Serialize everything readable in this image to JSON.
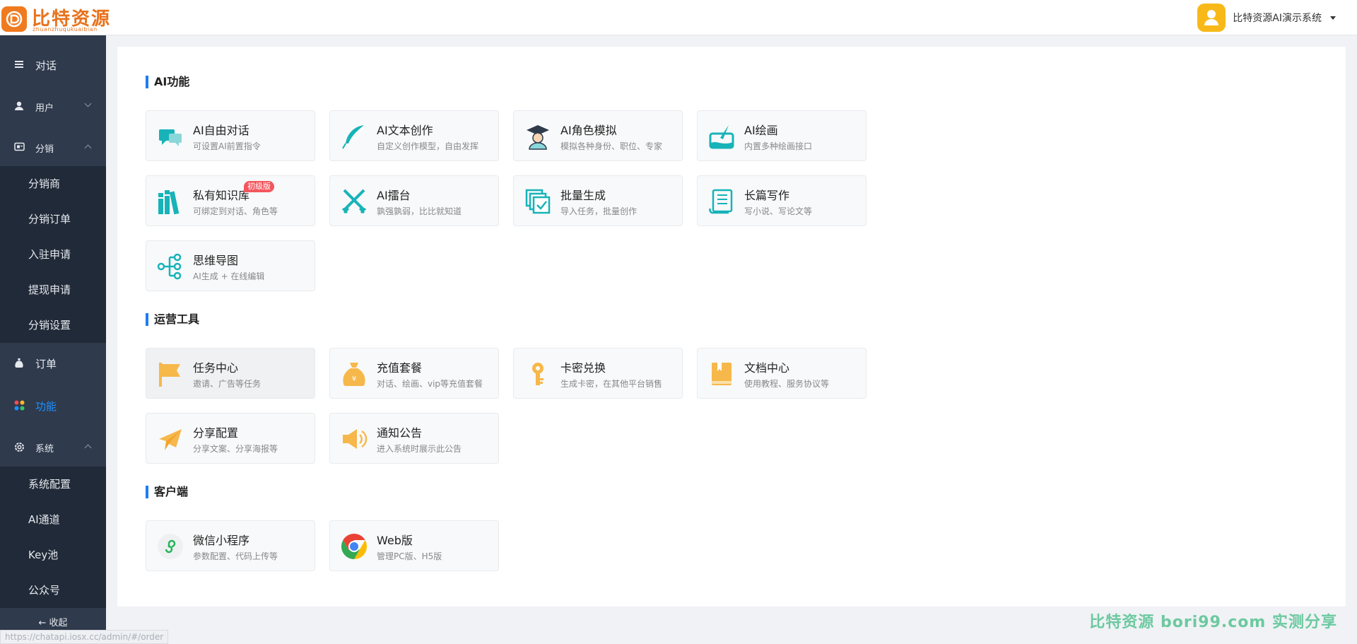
{
  "header": {
    "logo_title": "比特资源",
    "logo_subtitle": "zhuanzhuqukuaibian",
    "user_name": "比特资源AI演示系统"
  },
  "sidebar": {
    "items": [
      {
        "label": "对话",
        "icon": "menu-icon"
      },
      {
        "label": "用户",
        "icon": "user-icon"
      },
      {
        "label": "分销",
        "icon": "distribution-icon"
      },
      {
        "label": "订单",
        "icon": "money-bag-icon"
      },
      {
        "label": "功能",
        "icon": "grid-icon"
      },
      {
        "label": "系统",
        "icon": "gear-icon"
      }
    ],
    "distribution_sub": [
      "分销商",
      "分销订单",
      "入驻申请",
      "提现申请",
      "分销设置"
    ],
    "system_sub": [
      "系统配置",
      "AI通道",
      "Key池",
      "公众号"
    ],
    "collapse_label": "← 收起"
  },
  "sections": [
    {
      "title": "AI功能"
    },
    {
      "title": "运营工具"
    },
    {
      "title": "客户端"
    }
  ],
  "ai_cards": [
    {
      "title": "AI自由对话",
      "desc": "可设置AI前置指令",
      "icon": "chat-bubbles-icon"
    },
    {
      "title": "AI文本创作",
      "desc": "自定义创作模型，自由发挥",
      "icon": "feather-pen-icon"
    },
    {
      "title": "AI角色模拟",
      "desc": "模拟各种身份、职位、专家",
      "icon": "graduate-icon"
    },
    {
      "title": "AI绘画",
      "desc": "内置多种绘画接口",
      "icon": "paint-brush-icon"
    },
    {
      "title": "私有知识库",
      "desc": "可绑定到对话、角色等",
      "icon": "books-icon",
      "badge": "初级版"
    },
    {
      "title": "AI擂台",
      "desc": "孰强孰弱，比比就知道",
      "icon": "crossed-swords-icon"
    },
    {
      "title": "批量生成",
      "desc": "导入任务，批量创作",
      "icon": "batch-check-icon"
    },
    {
      "title": "长篇写作",
      "desc": "写小说、写论文等",
      "icon": "scroll-icon"
    },
    {
      "title": "思维导图",
      "desc": "AI生成 + 在线编辑",
      "icon": "mindmap-icon"
    }
  ],
  "ops_cards": [
    {
      "title": "任务中心",
      "desc": "邀请、广告等任务",
      "icon": "flag-icon"
    },
    {
      "title": "充值套餐",
      "desc": "对话、绘画、vip等充值套餐",
      "icon": "money-bag-icon"
    },
    {
      "title": "卡密兑换",
      "desc": "生成卡密，在其他平台销售",
      "icon": "key-icon"
    },
    {
      "title": "文档中心",
      "desc": "使用教程、服务协议等",
      "icon": "book-icon"
    },
    {
      "title": "分享配置",
      "desc": "分享文案、分享海报等",
      "icon": "paper-plane-icon"
    },
    {
      "title": "通知公告",
      "desc": "进入系统时展示此公告",
      "icon": "speaker-icon"
    }
  ],
  "client_cards": [
    {
      "title": "微信小程序",
      "desc": "参数配置、代码上传等",
      "icon": "wechat-miniprogram-icon"
    },
    {
      "title": "Web版",
      "desc": "管理PC版、H5版",
      "icon": "chrome-icon"
    }
  ],
  "watermark": "比特资源  bori99.com  实测分享",
  "status_url": "https://chatapi.iosx.cc/admin/#/order",
  "colors": {
    "accent": "#1e7cf2",
    "sidebar": "#2f3a4c",
    "sidebar_sub": "#212a38",
    "teal_icon": "#17b3b8",
    "orange_icon": "#f6b84a"
  }
}
